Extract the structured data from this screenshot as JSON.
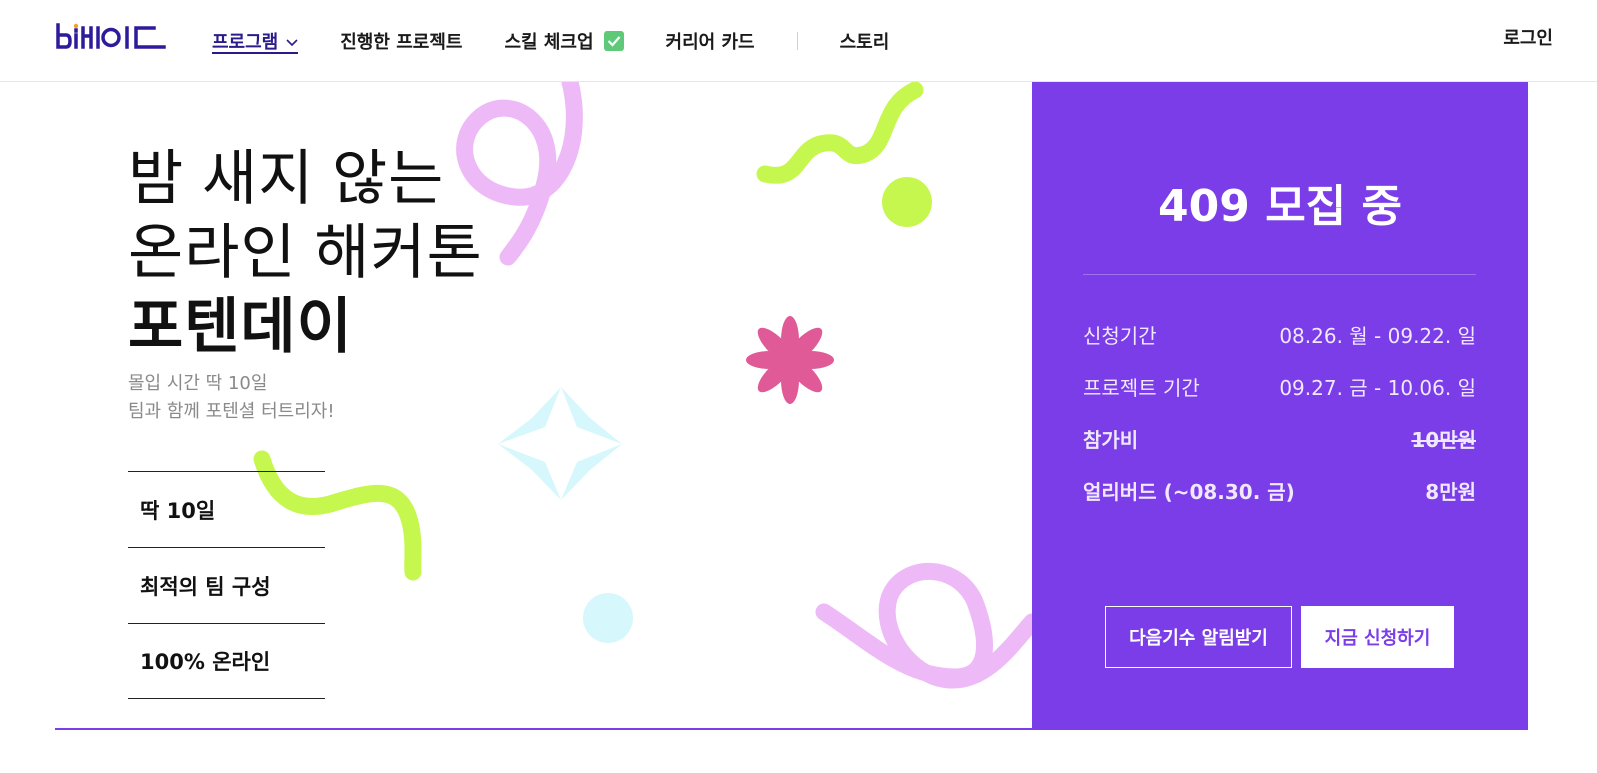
{
  "header": {
    "logo_icon": "bipaide-logo",
    "nav": [
      {
        "label": "프로그램",
        "icon": "chevron-down-icon",
        "active": true
      },
      {
        "label": "진행한 프로젝트"
      },
      {
        "label": "스킬 체크업",
        "icon": "check-icon"
      },
      {
        "label": "커리어 카드"
      },
      {
        "label": "스토리"
      }
    ],
    "login": "로그인"
  },
  "hero": {
    "headline_line1": "밤 새지 않는",
    "headline_line2": "온라인 해커톤",
    "headline_strong": "포텐데이",
    "sub_line1": "몰입 시간 딱 10일",
    "sub_line2": "팀과 함께 포텐셜 터트리자!",
    "features": [
      "딱 10일",
      "최적의 팀 구성",
      "100% 온라인"
    ]
  },
  "panel": {
    "title": "409 모집 중",
    "rows": [
      {
        "key": "신청기간",
        "value": "08.26. 월 - 09.22. 일"
      },
      {
        "key": "프로젝트 기간",
        "value": "09.27. 금 - 10.06. 일"
      },
      {
        "key": "참가비",
        "value": "10만원"
      },
      {
        "key": "얼리버드 (~08.30. 금)",
        "value": "8만원"
      }
    ],
    "btn_notify": "다음기수 알림받기",
    "btn_apply": "지금 신청하기"
  },
  "colors": {
    "accent": "#7a3de8",
    "nav_active": "#2a1a8a",
    "lime": "#c5f74f",
    "pink_light": "#eeb9f7",
    "pink": "#e05a97",
    "cyan_light": "#d6f7fc",
    "check_green": "#5fc97a"
  }
}
